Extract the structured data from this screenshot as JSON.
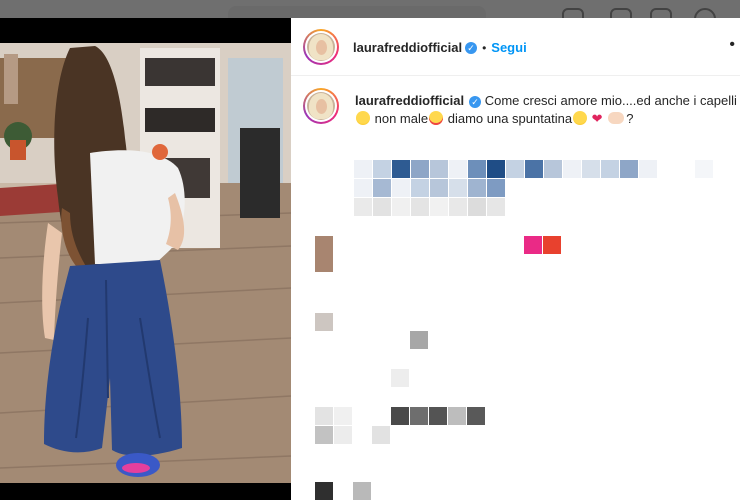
{
  "post": {
    "username": "laurafreddiofficial",
    "separator": "•",
    "follow_label": "Segui",
    "more_label": "•"
  },
  "caption": {
    "username": "laurafreddiofficial",
    "text_part1": "Come cresci amore mio....ed anche i capelli",
    "text_part2": "non male",
    "text_part3": "diamo una spuntatina",
    "text_part4": "?"
  },
  "icons": {
    "verified": "verified-badge-icon",
    "heart": "red-heart-emoji",
    "more": "more-options-icon"
  },
  "colors": {
    "follow": "#0095f6",
    "verified": "#3897f0",
    "heart": "#e0245e"
  }
}
